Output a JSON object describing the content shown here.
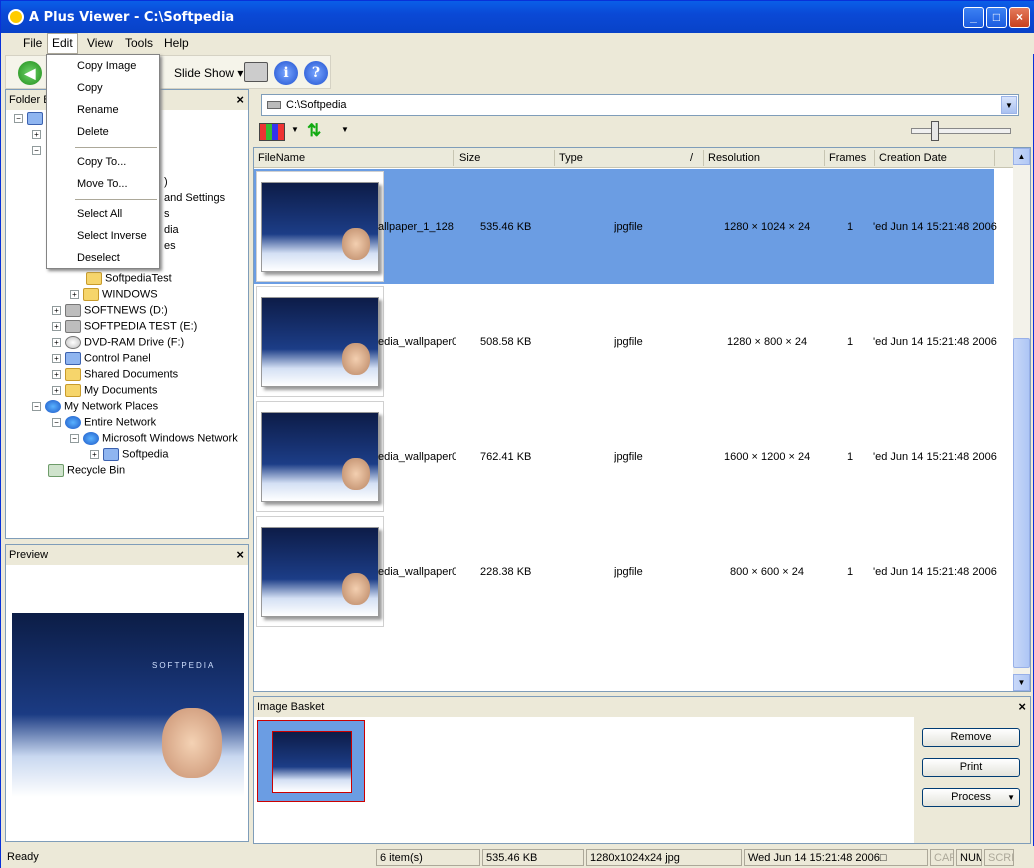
{
  "window": {
    "title": "A Plus Viewer - C:\\Softpedia"
  },
  "menubar": {
    "file": "File",
    "edit": "Edit",
    "view": "View",
    "tools": "Tools",
    "help": "Help"
  },
  "toolbar": {
    "slideshow_label": "Slide Show",
    "slideshow_arrow": "▾",
    "info_glyph": "i",
    "help_glyph": "?"
  },
  "edit_menu": {
    "items": [
      "Copy Image",
      "Copy",
      "Rename",
      "Delete",
      "Copy To...",
      "Move To...",
      "Select All",
      "Select Inverse",
      "Deselect"
    ]
  },
  "folder_pane": {
    "title": "Folder B",
    "tree": [
      "and Settings",
      "s",
      "dia",
      "es",
      "SoftpediaTest",
      "WINDOWS",
      "SOFTNEWS (D:)",
      "SOFTPEDIA TEST (E:)",
      "DVD-RAM Drive (F:)",
      "Control Panel",
      "Shared Documents",
      "My Documents",
      "My Network Places",
      "Entire Network",
      "Microsoft Windows Network",
      "Softpedia",
      "Recycle Bin"
    ]
  },
  "preview_pane": {
    "title": "Preview",
    "image_text": "SOFTPEDIA"
  },
  "path": {
    "value": "C:\\Softpedia"
  },
  "columns": [
    "FileName",
    "Size",
    "Type",
    "Resolution",
    "Frames",
    "Creation Date"
  ],
  "files": [
    {
      "name": "allpaper_1_128",
      "size": "535.46 KB",
      "type": "jpgfile",
      "resolution": "1280 × 1024 × 24",
      "frames": "1",
      "date": "'ed Jun 14 15:21:48 2006"
    },
    {
      "name": "edia_wallpaper0",
      "size": "508.58 KB",
      "type": "jpgfile",
      "resolution": "1280 × 800 × 24",
      "frames": "1",
      "date": "'ed Jun 14 15:21:48 2006"
    },
    {
      "name": "edia_wallpaper0",
      "size": "762.41 KB",
      "type": "jpgfile",
      "resolution": "1600 × 1200 × 24",
      "frames": "1",
      "date": "'ed Jun 14 15:21:48 2006"
    },
    {
      "name": "edia_wallpaper0",
      "size": "228.38 KB",
      "type": "jpgfile",
      "resolution": "800 × 600 × 24",
      "frames": "1",
      "date": "'ed Jun 14 15:21:48 2006"
    }
  ],
  "basket": {
    "title": "Image Basket",
    "remove": "Remove",
    "print": "Print",
    "process": "Process"
  },
  "status": {
    "ready": "Ready",
    "count": "6 item(s)",
    "size": "535.46 KB",
    "format": "1280x1024x24 jpg",
    "date": "Wed Jun 14 15:21:48 2006□",
    "cap": "CAP",
    "num": "NUM",
    "scrl": "SCRL"
  }
}
